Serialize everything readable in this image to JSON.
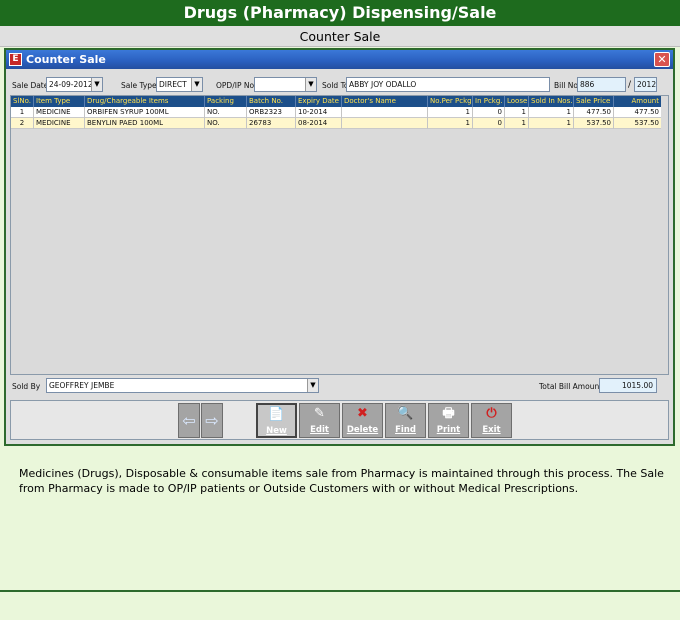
{
  "header": {
    "title": "Drugs (Pharmacy) Dispensing/Sale",
    "subtitle": "Counter Sale"
  },
  "window": {
    "title": "Counter Sale",
    "icon": "app-icon",
    "close_icon": "close-icon"
  },
  "form": {
    "sale_date_label": "Sale Date",
    "sale_date": "24-09-2012",
    "sale_type_label": "Sale Type",
    "sale_type": "DIRECT",
    "opd_label": "OPD/IP No.",
    "opd_value": "",
    "sold_to_label": "Sold To",
    "sold_to": "ABBY JOY ODALLO",
    "bill_label": "Bill No.",
    "bill_no": "886",
    "bill_sep": "/",
    "bill_year": "2012"
  },
  "table": {
    "headers": [
      "SlNo.",
      "Item Type",
      "Drug/Chargeable Items",
      "Packing",
      "Batch No.",
      "Expiry Date",
      "Doctor's Name",
      "No.Per Pckg",
      "In Pckg.",
      "Loose",
      "Sold In Nos.",
      "Sale Price",
      "Amount"
    ],
    "rows": [
      [
        "1",
        "MEDICINE",
        "ORBIFEN SYRUP 100ML",
        "NO.",
        "ORB2323",
        "10-2014",
        "",
        "1",
        "0",
        "1",
        "1",
        "477.50",
        "477.50"
      ],
      [
        "2",
        "MEDICINE",
        "BENYLIN PAED 100ML",
        "NO.",
        "26783",
        "08-2014",
        "",
        "1",
        "0",
        "1",
        "1",
        "537.50",
        "537.50"
      ]
    ]
  },
  "footer": {
    "sold_by_label": "Sold By",
    "sold_by": "GEOFFREY JEMBE",
    "total_label": "Total Bill Amount",
    "total": "1015.00"
  },
  "toolbar": {
    "prev_icon": "arrow-left-icon",
    "next_icon": "arrow-right-icon",
    "new_label": "New",
    "edit_label": "Edit",
    "delete_label": "Delete",
    "find_label": "Find",
    "print_label": "Print",
    "exit_label": "Exit"
  },
  "description": "Medicines (Drugs), Disposable & consumable items sale from Pharmacy is maintained through this process. The Sale from Pharmacy is made to OP/IP patients or Outside Customers with or without Medical Prescriptions.",
  "colors": {
    "banner": "#1e6b1e",
    "grid_header": "#1c4f8a",
    "grid_header_text": "#ffe14d",
    "page_bg": "#eaf7da"
  }
}
